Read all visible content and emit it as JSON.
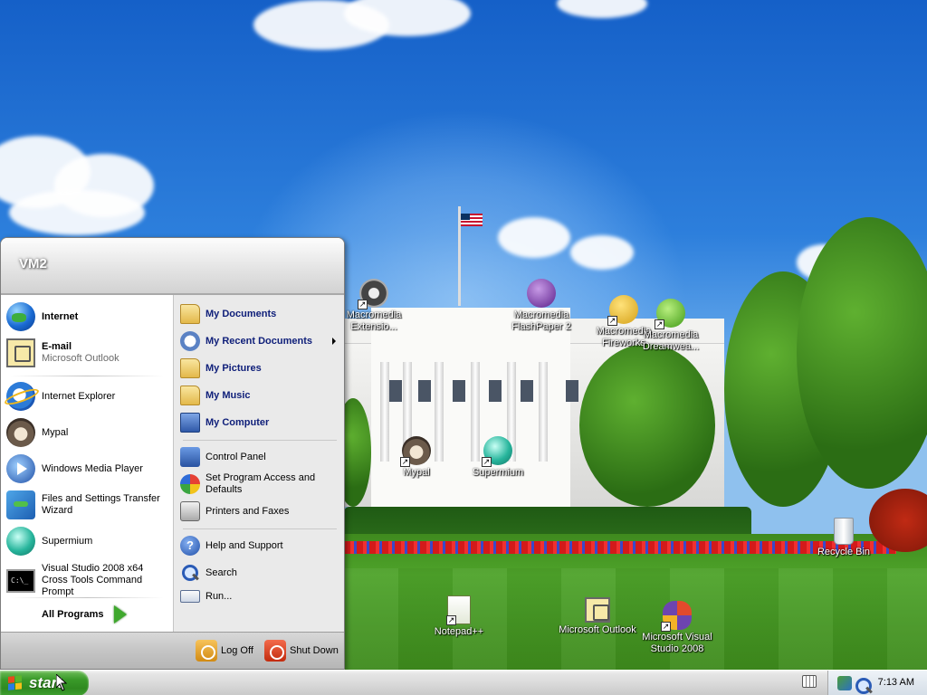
{
  "desktop": {
    "icons": [
      {
        "id": "mm-extension",
        "label": "Macromedia Extensio...",
        "icon": "macromedia-extension-icon"
      },
      {
        "id": "mm-flashpaper",
        "label": "Macromedia FlashPaper 2",
        "icon": "macromedia-flashpaper-icon"
      },
      {
        "id": "mm-fireworks",
        "label": "Macromedia Fireworks",
        "icon": "macromedia-fireworks-icon"
      },
      {
        "id": "mm-dreamweaver",
        "label": "Macromedia Dreamwea...",
        "icon": "macromedia-dreamweaver-icon"
      },
      {
        "id": "mypal",
        "label": "Mypal",
        "icon": "mypal-icon"
      },
      {
        "id": "supermium",
        "label": "Supermium",
        "icon": "supermium-icon"
      },
      {
        "id": "recycle-bin",
        "label": "Recycle Bin",
        "icon": "recycle-bin-icon"
      },
      {
        "id": "notepadpp",
        "label": "Notepad++",
        "icon": "notepadpp-icon"
      },
      {
        "id": "outlook",
        "label": "Microsoft Outlook",
        "icon": "outlook-icon"
      },
      {
        "id": "vs2008",
        "label": "Microsoft Visual Studio 2008",
        "icon": "visual-studio-icon"
      }
    ]
  },
  "start_menu": {
    "user": "VM2",
    "pinned": [
      {
        "label": "Internet",
        "icon": "internet-globe-icon"
      },
      {
        "label": "E-mail",
        "sublabel": "Microsoft Outlook",
        "icon": "outlook-icon"
      }
    ],
    "recent_programs": [
      {
        "label": "Internet Explorer",
        "icon": "internet-explorer-icon"
      },
      {
        "label": "Mypal",
        "icon": "mypal-icon"
      },
      {
        "label": "Windows Media Player",
        "icon": "media-player-icon"
      },
      {
        "label": "Files and Settings Transfer Wizard",
        "icon": "transfer-wizard-icon"
      },
      {
        "label": "Supermium",
        "icon": "supermium-icon"
      },
      {
        "label": "Visual Studio 2008 x64 Cross Tools Command Prompt",
        "icon": "command-prompt-icon"
      }
    ],
    "all_programs": "All Programs",
    "places": [
      {
        "label": "My Documents",
        "icon": "my-documents-icon"
      },
      {
        "label": "My Recent Documents",
        "icon": "recent-documents-icon",
        "submenu": true
      },
      {
        "label": "My Pictures",
        "icon": "my-pictures-icon"
      },
      {
        "label": "My Music",
        "icon": "my-music-icon"
      },
      {
        "label": "My Computer",
        "icon": "my-computer-icon"
      }
    ],
    "system": [
      {
        "label": "Control Panel",
        "icon": "control-panel-icon"
      },
      {
        "label": "Set Program Access and Defaults",
        "icon": "program-access-icon"
      },
      {
        "label": "Printers and Faxes",
        "icon": "printer-icon"
      }
    ],
    "help": [
      {
        "label": "Help and Support",
        "icon": "help-icon"
      },
      {
        "label": "Search",
        "icon": "search-icon"
      },
      {
        "label": "Run...",
        "icon": "run-icon"
      }
    ],
    "footer": {
      "log_off": "Log Off",
      "shut_down": "Shut Down"
    }
  },
  "taskbar": {
    "start_label": "start",
    "clock": "7:13 AM"
  },
  "colors": {
    "start_button": "#3a9a2a",
    "place_text": "#10207a",
    "menu_right_pane": "#eaeaea"
  }
}
